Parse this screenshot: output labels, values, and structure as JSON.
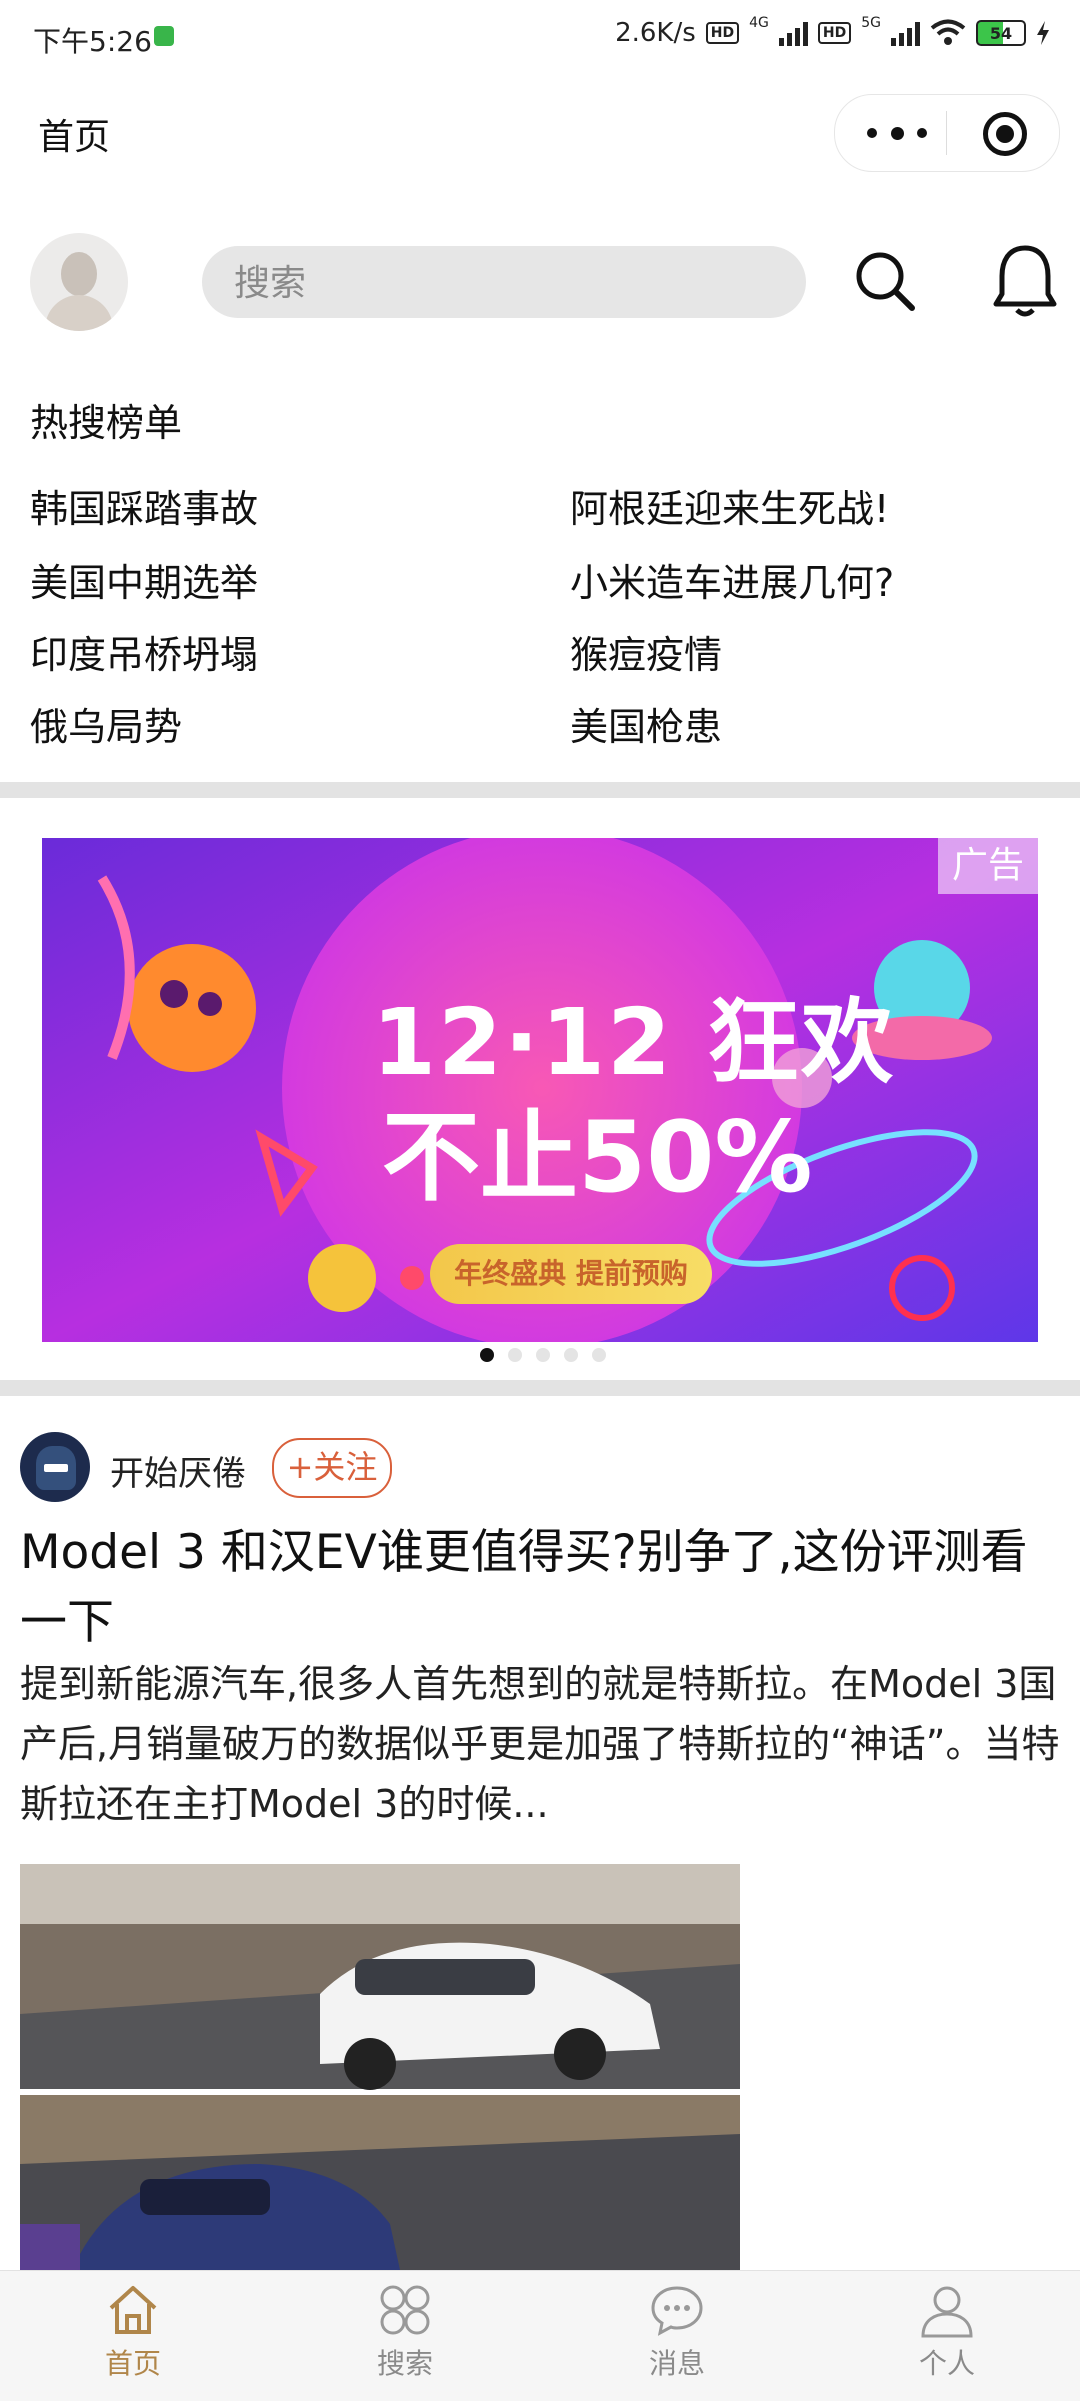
{
  "status_bar": {
    "time": "下午5:26",
    "net_speed": "2.6K/s",
    "signal_1": "4G",
    "signal_2": "5G",
    "battery": "54"
  },
  "nav": {
    "title": "首页"
  },
  "search": {
    "placeholder": "搜索"
  },
  "hot_list": {
    "title": "热搜榜单",
    "items": [
      "韩国踩踏事故",
      "阿根廷迎来生死战!",
      "美国中期选举",
      "小米造车进展几何?",
      "印度吊桥坍塌",
      "猴痘疫情",
      "俄乌局势",
      "美国枪患"
    ]
  },
  "banner": {
    "ad_tag": "广告",
    "headline": "12·12 狂欢",
    "subline": "不止50%",
    "pill": "年终盛典 提前预购",
    "dots": 5,
    "active_dot": 0
  },
  "post": {
    "author": "开始厌倦",
    "follow_label": "+关注",
    "title": "Model 3 和汉EV谁更值得买?别争了,这份评测看一下",
    "excerpt": "提到新能源汽车,很多人首先想到的就是特斯拉。在Model 3国产后,月销量破万的数据似乎更是加强了特斯拉的“神话”。当特斯拉还在主打Model 3的时候..."
  },
  "tabbar": {
    "items": [
      {
        "label": "首页",
        "icon": "home-icon",
        "active": true
      },
      {
        "label": "搜索",
        "icon": "grid-icon",
        "active": false
      },
      {
        "label": "消息",
        "icon": "chat-icon",
        "active": false
      },
      {
        "label": "个人",
        "icon": "user-icon",
        "active": false
      }
    ]
  },
  "colors": {
    "accent": "#b0864a",
    "follow": "#d9603b",
    "divider": "#e3e3e3"
  }
}
